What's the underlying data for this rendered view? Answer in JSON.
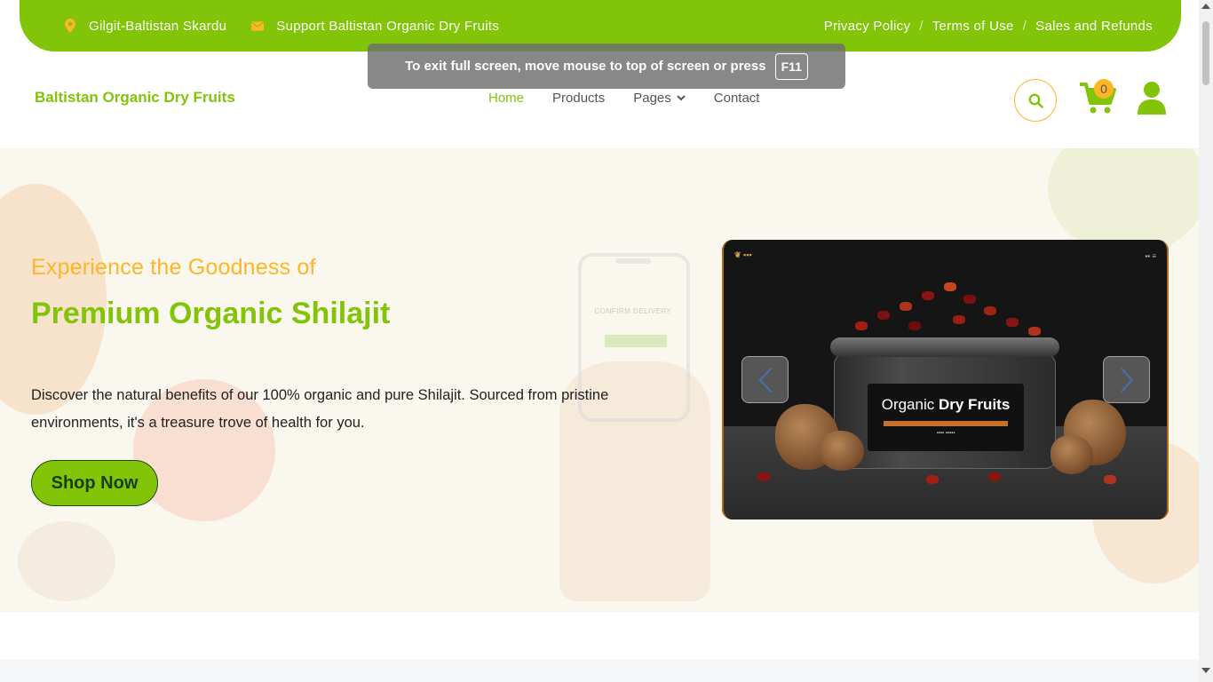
{
  "colors": {
    "brand": "#81c408",
    "accent": "#ffb524",
    "text": "#212121"
  },
  "topbar": {
    "location": "Gilgit-Baltistan Skardu",
    "location_icon": "map-marker-icon",
    "support": "Support Baltistan Organic Dry Fruits",
    "support_icon": "envelope-icon",
    "links": [
      "Privacy Policy",
      "Terms of Use",
      "Sales and Refunds"
    ],
    "separator": "/"
  },
  "fullscreen_notice": {
    "text": "To exit full screen, move mouse to top of screen or press",
    "key": "F11"
  },
  "header": {
    "brand": "Baltistan Organic Dry Fruits",
    "menu": {
      "home": "Home",
      "products": "Products",
      "pages": "Pages",
      "contact": "Contact"
    },
    "active": "Home",
    "cart_count": "0",
    "icons": {
      "search": "search-icon",
      "cart": "shopping-cart-icon",
      "user": "user-icon"
    }
  },
  "hero": {
    "subheading": "Experience the Goodness of",
    "heading": "Premium Organic Shilajit",
    "description": "Discover the natural benefits of our 100% organic and pure Shilajit. Sourced from pristine environments, it's a treasure trove of health for you.",
    "button": "Shop Now",
    "phone_text": "CONFIRM DELIVERY",
    "carousel": {
      "label_word1": "Organic",
      "label_word2": "Dry Fruits",
      "prev_icon": "chevron-left-icon",
      "next_icon": "chevron-right-icon"
    }
  }
}
